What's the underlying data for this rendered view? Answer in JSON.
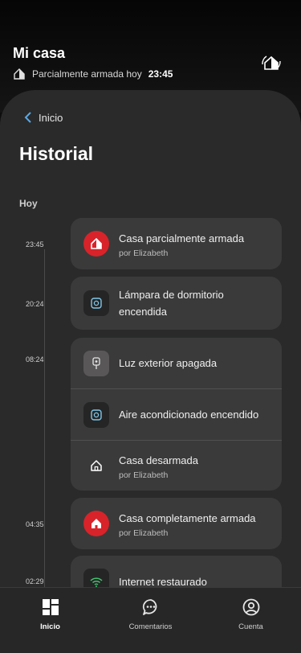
{
  "header": {
    "title": "Mi casa",
    "status_text": "Parcialmente armada hoy",
    "status_time": "23:45"
  },
  "nav": {
    "back_label": "Inicio"
  },
  "page": {
    "title": "Historial",
    "section": "Hoy"
  },
  "times": [
    "23:45",
    "20:24",
    "08:24",
    "04:35",
    "02:29"
  ],
  "events": [
    {
      "label": "Casa parcialmente armada",
      "sub": "por Elizabeth"
    },
    {
      "label": "Lámpara de dormitorio encendida"
    },
    {
      "label": "Luz exterior apagada"
    },
    {
      "label": "Aire acondicionado encendido"
    },
    {
      "label": "Casa desarmada",
      "sub": "por Elizabeth"
    },
    {
      "label": "Casa completamente armada",
      "sub": "por Elizabeth"
    },
    {
      "label": "Internet restaurado"
    }
  ],
  "tabs": [
    "Inicio",
    "Comentarios",
    "Cuenta"
  ],
  "colors": {
    "accent_red": "#d8232a",
    "link_blue": "#5aa9e6",
    "plug_blue": "#7fc7e8",
    "wifi_green": "#3ec46d"
  }
}
